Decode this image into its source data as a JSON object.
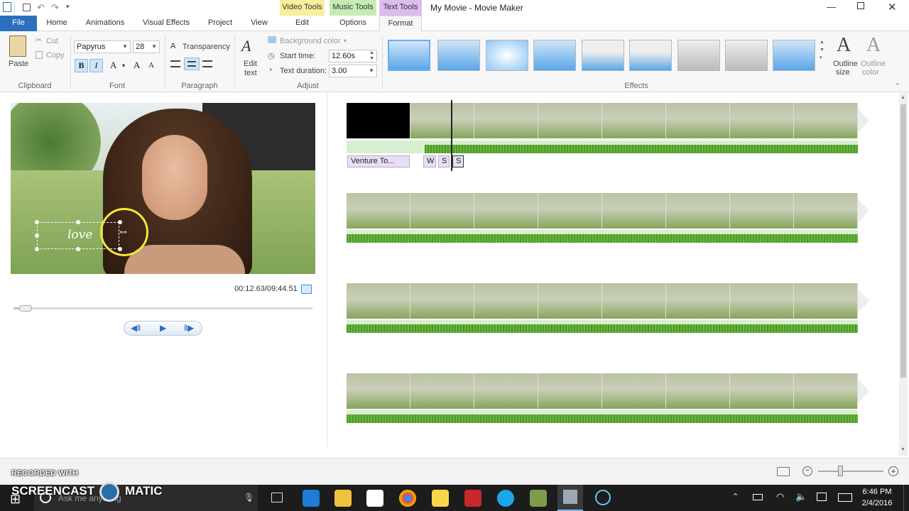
{
  "window": {
    "title": "My Movie - Movie Maker",
    "context_tabs": [
      {
        "label": "Video Tools",
        "color": "#f7ef99"
      },
      {
        "label": "Music Tools",
        "color": "#c6ecb5"
      },
      {
        "label": "Text Tools",
        "color": "#dcbcef"
      }
    ]
  },
  "tabs": {
    "file": "File",
    "home": "Home",
    "animations": "Animations",
    "visual_effects": "Visual Effects",
    "project": "Project",
    "view": "View",
    "edit": "Edit",
    "options": "Options",
    "format": "Format"
  },
  "ribbon": {
    "clipboard": {
      "paste": "Paste",
      "cut": "Cut",
      "copy": "Copy",
      "label": "Clipboard"
    },
    "font": {
      "family": "Papyrus",
      "size": "28",
      "label": "Font",
      "bold": "B",
      "italic": "I",
      "color": "A",
      "grow": "A",
      "shrink": "A"
    },
    "paragraph": {
      "transparency": "Transparency",
      "label": "Paragraph"
    },
    "adjust": {
      "edit_text": "Edit",
      "edit_text2": "text",
      "background_color": "Background color",
      "start_time_label": "Start time:",
      "start_time_value": "12.60s",
      "text_duration_label": "Text duration:",
      "text_duration_value": "3.00",
      "label": "Adjust"
    },
    "effects": {
      "label": "Effects",
      "outline_size": "Outline",
      "outline_size2": "size",
      "outline_color": "Outline",
      "outline_color2": "color"
    }
  },
  "preview": {
    "caption_text": "love",
    "timecode": "00:12.63/09:44.51",
    "progress": 0.02
  },
  "timeline": {
    "captions": [
      "Venture To...",
      "W",
      "S",
      "S"
    ]
  },
  "watermark": {
    "line1": "RECORDED WITH",
    "line2a": "SCREENCAST",
    "line2b": "MATIC"
  },
  "taskbar": {
    "search_placeholder": "Ask me anything",
    "time": "6:46 PM",
    "date": "2/4/2016"
  },
  "colors": {
    "file_tab": "#2b6fbd",
    "accent": "#3b8ee8",
    "taskbar": "#1c1c1c"
  }
}
